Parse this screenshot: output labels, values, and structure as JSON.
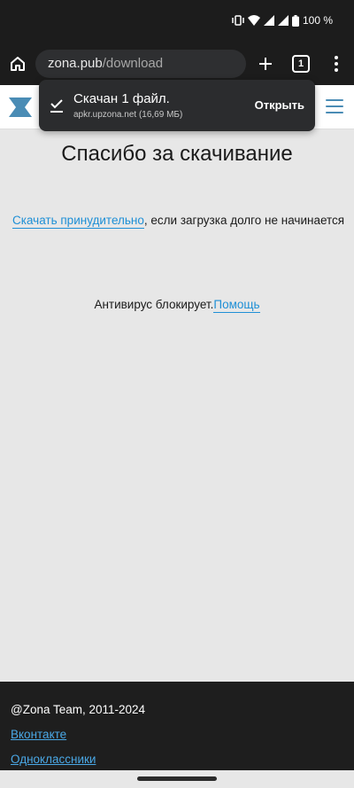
{
  "status_bar": {
    "battery_text": "100 %"
  },
  "browser": {
    "url_host": "zona.pub",
    "url_path": "/download",
    "tab_count": "1"
  },
  "download_toast": {
    "title": "Скачан 1 файл.",
    "subtitle": "apkr.upzona.net (16,69 МБ)",
    "action_label": "Открыть"
  },
  "page": {
    "title": "Спасибо за скачивание",
    "force_link": "Скачать принудительно",
    "force_suffix": ", если загрузка долго не начинается",
    "antivirus_text": "Антивирус блокирует.",
    "help_link": "Помощь"
  },
  "footer": {
    "copyright": "@Zona Team, 2011-2024",
    "links": [
      "Вконтакте",
      "Одноклассники"
    ]
  },
  "colors": {
    "accent_link": "#1e8fd6",
    "logo_blue": "#4a8cb5",
    "page_bg": "#e7e7e7",
    "footer_bg": "#1e1e1e"
  },
  "icons": [
    "vibrate-icon",
    "wifi-icon",
    "signal-icon",
    "battery-icon",
    "home-icon",
    "plus-icon",
    "tabs-icon",
    "more-vert-icon",
    "download-done-icon",
    "zona-logo-icon",
    "hamburger-icon"
  ]
}
